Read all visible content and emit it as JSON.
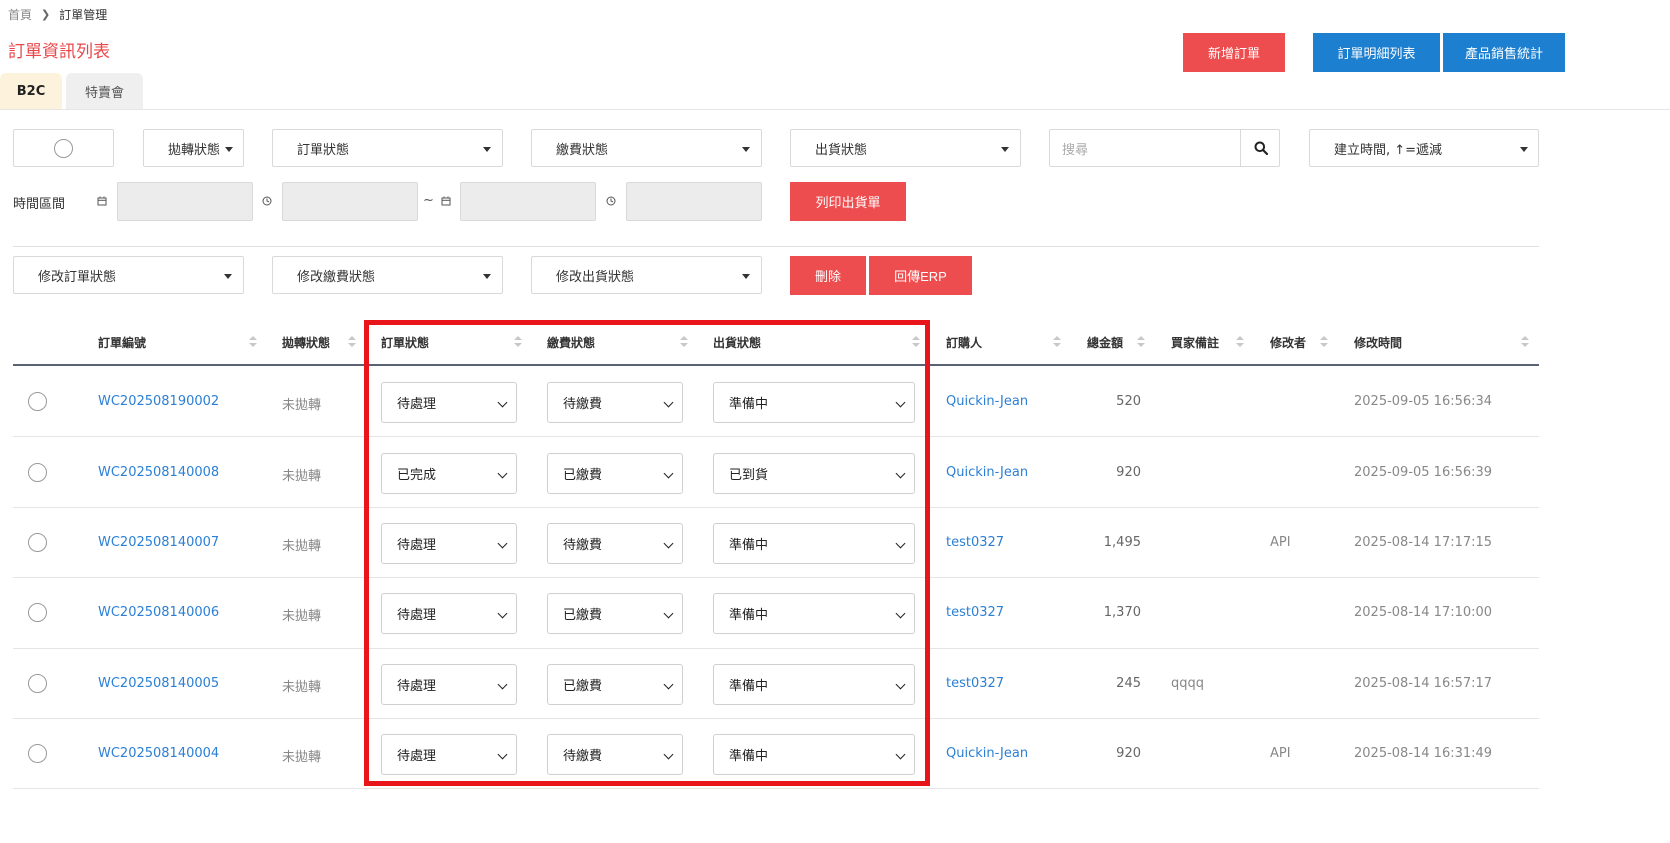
{
  "breadcrumb": {
    "home": "首頁",
    "current": "訂單管理"
  },
  "page_title": "訂單資訊列表",
  "actions": {
    "add_order": "新增訂單",
    "order_detail_list": "訂單明細列表",
    "product_sales_stats": "產品銷售統計"
  },
  "tabs": [
    {
      "label": "B2C",
      "active": true
    },
    {
      "label": "特賣會",
      "active": false
    }
  ],
  "filters": {
    "transfer_status": "拋轉狀態",
    "order_status": "訂單狀態",
    "payment_status": "繳費狀態",
    "shipping_status": "出貨狀態",
    "search_placeholder": "搜尋",
    "sort": "建立時間, ↑=遞減",
    "time_range_label": "時間區間",
    "tilde": "~",
    "print_shipping": "列印出貨單"
  },
  "bulk": {
    "modify_order_status": "修改訂單狀態",
    "modify_payment_status": "修改繳費狀態",
    "modify_shipping_status": "修改出貨狀態",
    "delete": "刪除",
    "return_erp": "回傳ERP"
  },
  "table": {
    "headers": {
      "order_no": "訂單編號",
      "transfer_status": "拋轉狀態",
      "order_status": "訂單狀態",
      "payment_status": "繳費狀態",
      "shipping_status": "出貨狀態",
      "buyer": "訂購人",
      "total": "總金額",
      "buyer_note": "買家備註",
      "modifier": "修改者",
      "modified_time": "修改時間"
    },
    "rows": [
      {
        "order_no": "WC202508190002",
        "transfer": "未拋轉",
        "order_status": "待處理",
        "payment": "待繳費",
        "shipping": "準備中",
        "buyer": "Quickin-Jean",
        "total": "520",
        "note": "",
        "modifier": "",
        "time": "2025-09-05 16:56:34"
      },
      {
        "order_no": "WC202508140008",
        "transfer": "未拋轉",
        "order_status": "已完成",
        "payment": "已繳費",
        "shipping": "已到貨",
        "buyer": "Quickin-Jean",
        "total": "920",
        "note": "",
        "modifier": "",
        "time": "2025-09-05 16:56:39"
      },
      {
        "order_no": "WC202508140007",
        "transfer": "未拋轉",
        "order_status": "待處理",
        "payment": "待繳費",
        "shipping": "準備中",
        "buyer": "test0327",
        "total": "1,495",
        "note": "",
        "modifier": "API",
        "time": "2025-08-14 17:17:15"
      },
      {
        "order_no": "WC202508140006",
        "transfer": "未拋轉",
        "order_status": "待處理",
        "payment": "已繳費",
        "shipping": "準備中",
        "buyer": "test0327",
        "total": "1,370",
        "note": "",
        "modifier": "",
        "time": "2025-08-14 17:10:00"
      },
      {
        "order_no": "WC202508140005",
        "transfer": "未拋轉",
        "order_status": "待處理",
        "payment": "已繳費",
        "shipping": "準備中",
        "buyer": "test0327",
        "total": "245",
        "note": "qqqq",
        "modifier": "",
        "time": "2025-08-14 16:57:17"
      },
      {
        "order_no": "WC202508140004",
        "transfer": "未拋轉",
        "order_status": "待處理",
        "payment": "待繳費",
        "shipping": "準備中",
        "buyer": "Quickin-Jean",
        "total": "920",
        "note": "",
        "modifier": "API",
        "time": "2025-08-14 16:31:49"
      }
    ]
  },
  "colors": {
    "accent_red": "#ee4d4f",
    "accent_blue": "#1c7fcf",
    "link": "#2b7fd4",
    "highlight": "#e8151b",
    "active_tab": "#fdf3dc"
  }
}
